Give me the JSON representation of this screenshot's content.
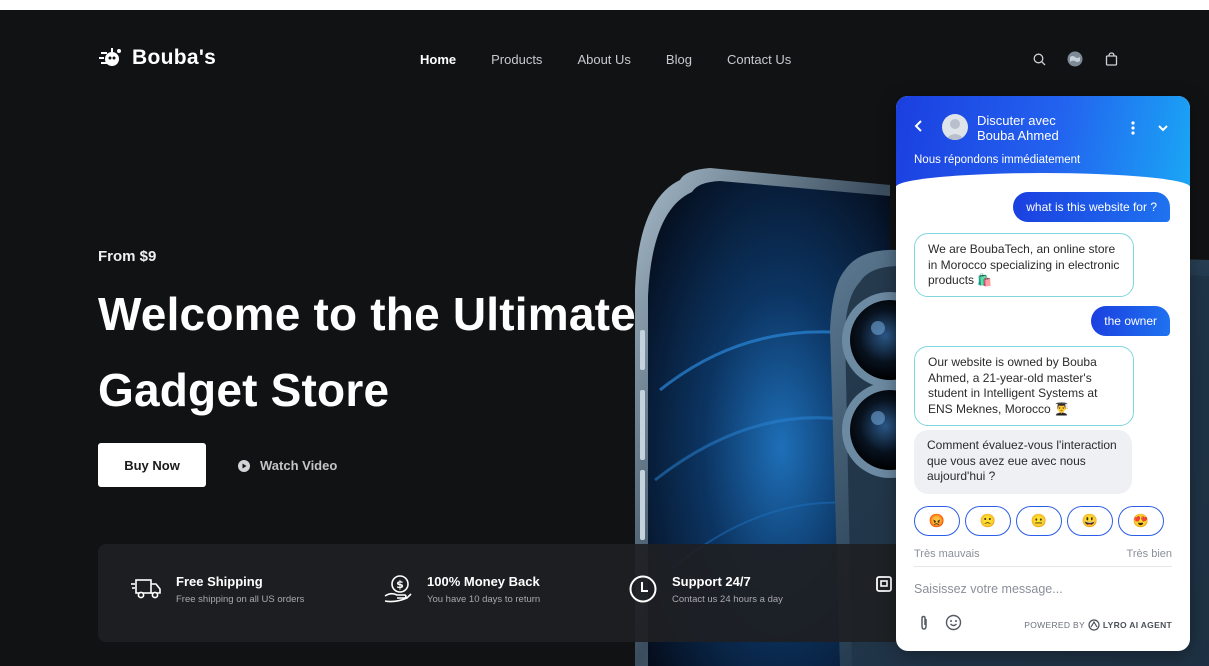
{
  "brand": {
    "name": "Bouba's"
  },
  "nav": {
    "items": [
      {
        "label": "Home",
        "active": true
      },
      {
        "label": "Products",
        "active": false
      },
      {
        "label": "About Us",
        "active": false
      },
      {
        "label": "Blog",
        "active": false
      },
      {
        "label": "Contact Us",
        "active": false
      }
    ]
  },
  "header_icons": [
    "search-icon",
    "globe-icon",
    "shopping-bag-icon"
  ],
  "hero": {
    "eyebrow": "From $9",
    "title_line1": "Welcome to the Ultimate",
    "title_line2": "Gadget Store",
    "buy_label": "Buy Now",
    "watch_label": "Watch Video"
  },
  "features": [
    {
      "icon": "truck-icon",
      "title": "Free Shipping",
      "subtitle": "Free shipping on all US orders"
    },
    {
      "icon": "money-hand-icon",
      "title": "100% Money Back",
      "subtitle": "You have 10 days to return"
    },
    {
      "icon": "clock-icon",
      "title": "Support 24/7",
      "subtitle": "Contact us 24 hours a day"
    }
  ],
  "chat": {
    "header_line1": "Discuter avec",
    "header_line2": "Bouba Ahmed",
    "status": "Nous répondons immédiatement",
    "messages": [
      {
        "from": "user",
        "text": "what is this website for ?"
      },
      {
        "from": "bot",
        "text": "We are BoubaTech, an online store in Morocco specializing in electronic products 🛍️"
      },
      {
        "from": "user",
        "text": "the owner"
      },
      {
        "from": "bot",
        "text": "Our website is owned by Bouba Ahmed, a 21-year-old master's student in Intelligent Systems at ENS Meknes, Morocco 👨‍🎓"
      },
      {
        "from": "bot",
        "text": "Comment évaluez-vous l'interaction que vous avez eue avec nous aujourd'hui ?"
      }
    ],
    "rating_emojis": [
      "😡",
      "🙁",
      "😐",
      "😃",
      "😍"
    ],
    "rating_low": "Très mauvais",
    "rating_high": "Très bien",
    "input_placeholder": "Saisissez votre message...",
    "powered_prefix": "POWERED BY",
    "powered_brand": "LYRO AI AGENT"
  },
  "colors": {
    "background": "#111214",
    "chat_accent": "#1f5ae8",
    "bot_border": "#7fd6df"
  }
}
